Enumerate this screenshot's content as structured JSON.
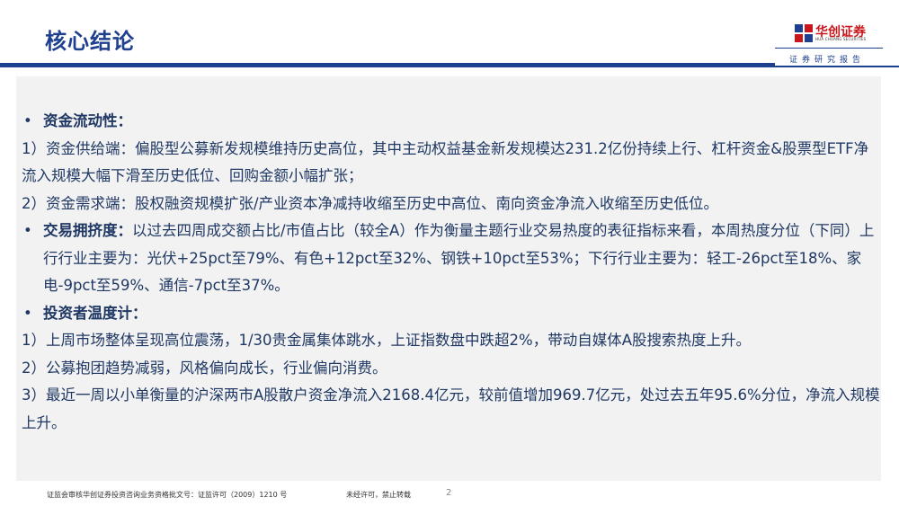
{
  "header": {
    "title": "核心结论",
    "logo_cn": "华创证券",
    "logo_en": "HUA CHUANG SECURITIES",
    "report_label": "证券研究报告",
    "brand_color": "#1f3f8f",
    "logo_color": "#c8161d"
  },
  "content": {
    "section1_heading": "资金流动性：",
    "s1_item1": "1）资金供给端：偏股型公募新发规模维持历史高位，其中主动权益基金新发规模达231.2亿份持续上行、杠杆资金&股票型ETF净流入规模大幅下滑至历史低位、回购金额小幅扩张；",
    "s1_item2": "2）资金需求端：股权融资规模扩张/产业资本净减持收缩至历史中高位、南向资金净流入收缩至历史低位。",
    "section2_heading": "交易拥挤度：",
    "section2_text": "以过去四周成交额占比/市值占比（较全A）作为衡量主题行业交易热度的表征指标来看，本周热度分位（下同）上行行业主要为：光伏+25pct至79%、有色+12pct至32%、钢铁+10pct至53%；下行行业主要为：轻工-26pct至18%、家电-9pct至59%、通信-7pct至37%。",
    "section3_heading": "投资者温度计：",
    "s3_item1": "1）上周市场整体呈现高位震荡，1/30贵金属集体跳水，上证指数盘中跌超2%，带动自媒体A股搜索热度上升。",
    "s3_item2": "2）公募抱团趋势减弱，风格偏向成长，行业偏向消费。",
    "s3_item3": "3）最近一周以小单衡量的沪深两市A股散户资金净流入2168.4亿元，较前值增加969.7亿元，处过去五年95.6%分位，净流入规模上升。",
    "bullet": "•"
  },
  "footer": {
    "license": "证监会审核华创证券投资咨询业务资格批文号：证监许可（2009）1210 号",
    "note": "未经许可，禁止转载",
    "page": "2"
  }
}
